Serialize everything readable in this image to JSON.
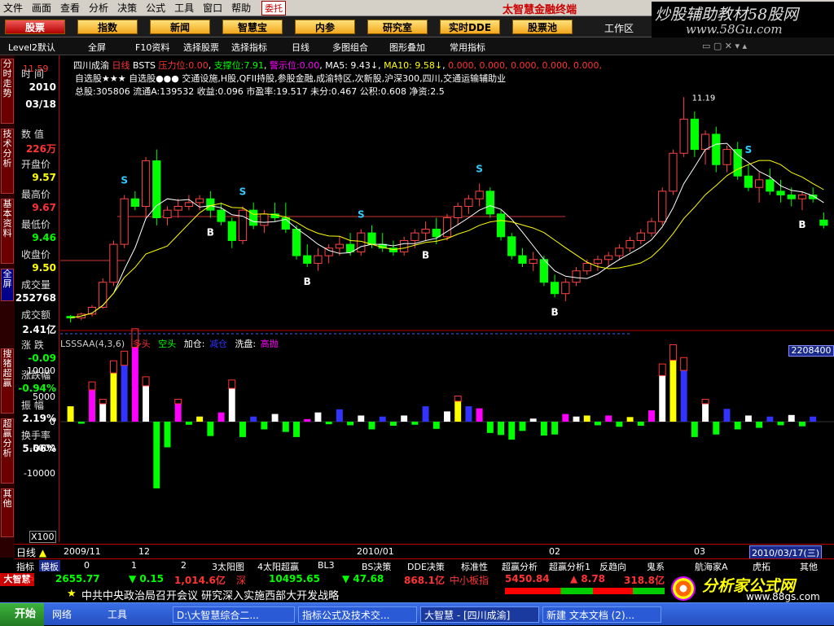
{
  "menubar": {
    "items": [
      "文件",
      "画面",
      "查看",
      "分析",
      "决策",
      "公式",
      "工具",
      "窗口",
      "帮助"
    ],
    "weituo": "委托",
    "brand": "太智慧金融终端"
  },
  "watermark": {
    "line1": "炒股辅助教材58股网",
    "line2": "www.58Gu.com"
  },
  "toolbar": {
    "buttons": [
      "股票",
      "指数",
      "新闻",
      "智慧宝",
      "内参",
      "研究室",
      "实时DDE",
      "股票池"
    ],
    "workarea": "工作区"
  },
  "subbar": {
    "items": [
      "Level2默认",
      "全屏",
      "F10资料",
      "选择股票",
      "选择指标",
      "日线",
      "多图组合",
      "图形叠加",
      "常用指标"
    ]
  },
  "lefttabs": [
    "分时走势",
    "技术分析",
    "基本资料",
    "全屏",
    "搜猪超赢",
    "超赢分析",
    "其他"
  ],
  "leftpanel": {
    "rows": [
      {
        "label": "时 间",
        "value": "2010",
        "color": "#fff"
      },
      {
        "label": "",
        "value": "03/18",
        "color": "#fff"
      },
      {
        "label": "数 值",
        "value": "226万",
        "color": "#f33"
      },
      {
        "label": "开盘价",
        "value": "9.57",
        "color": "#ff0"
      },
      {
        "label": "最高价",
        "value": "9.67",
        "color": "#f33"
      },
      {
        "label": "最低价",
        "value": "9.46",
        "color": "#0f0"
      },
      {
        "label": "收盘价",
        "value": "9.50",
        "color": "#ff0"
      },
      {
        "label": "成交量",
        "value": "252768",
        "color": "#fff"
      },
      {
        "label": "成交额",
        "value": "2.41亿",
        "color": "#fff"
      },
      {
        "label": "涨 跌",
        "value": "-0.09",
        "color": "#0f0"
      },
      {
        "label": "涨跌幅",
        "value": "-0.94%",
        "color": "#0f0"
      },
      {
        "label": "振 幅",
        "value": "2.19%",
        "color": "#fff"
      },
      {
        "label": "换手率",
        "value": "5.06%",
        "color": "#fff"
      }
    ],
    "top_price": "11.59"
  },
  "header": {
    "line1": {
      "name": "四川成渝",
      "period": "日线",
      "formula": "BSTS",
      "pressure_label": "压力位:",
      "pressure": "0.00",
      "support_label": "支撑位:",
      "support": "7.91",
      "warn_label": "警示位:",
      "warn": "0.00",
      "ma5": "MA5: 9.43↓",
      "ma10": "MA10: 9.58↓",
      "rest": "0.000, 0.000, 0.000, 0.000, 0.000,"
    },
    "line2": "自选股★★★ 自选股●●● 交通设施,H股,QFII持股,参股金融,成渝特区,次新股,沪深300,四川,交通运输辅助业",
    "line3": "总股:305806 流通A:139532 收益:0.096 市盈率:19.517 未分:0.467 公积:0.608 净资:2.5"
  },
  "subchart": {
    "name": "LSSSAA(4,3,6)",
    "legend": [
      {
        "t": "多头",
        "c": "#f33"
      },
      {
        "t": "空头",
        "c": "#0f0"
      },
      {
        "t": "加仓:",
        "c": "#fff"
      },
      {
        "t": "减仓",
        "c": "#33f"
      },
      {
        "t": "洗盘:",
        "c": "#fff"
      },
      {
        "t": "高抛",
        "c": "#f0f"
      }
    ],
    "bigval": "2208400"
  },
  "xaxis": {
    "period": "日线",
    "labels": [
      "2009/11",
      "12",
      "2010/01",
      "02",
      "03"
    ],
    "current": "2010/03/17(三)",
    "zoom": "X100"
  },
  "tabs": [
    "指标",
    "模板",
    "0",
    "1",
    "2",
    "3太阳图",
    "4太阳超赢",
    "BL3",
    "BS决策",
    "DDE决策",
    "标准性",
    "超赢分析",
    "超赢分析1",
    "反趋向",
    "鬼系",
    "航海家A",
    "虎拓",
    "其他"
  ],
  "status": {
    "sh_label": "沪",
    "sh": "2655.77",
    "sh_chg": "▼ 0.15",
    "sh_amt": "1,014.6亿",
    "sz_label": "深",
    "sz": "10495.65",
    "sz_chg": "▼ 47.68",
    "sz_amt": "868.1亿",
    "news": "中共中央政治局召开会议 研究深入实施西部大开发战略",
    "sme_label": "中小板指",
    "sme": "5450.84",
    "sme_chg": "▲ 8.78",
    "sme_amt": "318.8亿",
    "logo_left": "大智慧"
  },
  "taskbar": {
    "start": "开始",
    "items": [
      "网络",
      "工具",
      "D:\\大智慧综合二...",
      "指标公式及技术交...",
      "大智慧 - [四川成渝]",
      "新建 文本文档 (2)..."
    ]
  },
  "logo": {
    "text": "分析家公式网",
    "url": "www.88gs.com"
  },
  "chart_data": {
    "type": "candlestick",
    "ylim": [
      8.2,
      11.59
    ],
    "ma_lines": [
      "MA5",
      "MA10"
    ],
    "candles": [
      [
        8.3,
        8.32,
        8.22,
        8.28
      ],
      [
        8.28,
        8.35,
        8.25,
        8.33
      ],
      [
        8.33,
        8.45,
        8.3,
        8.42
      ],
      [
        8.42,
        8.8,
        8.4,
        8.75
      ],
      [
        8.75,
        9.3,
        8.7,
        9.25
      ],
      [
        9.25,
        9.9,
        9.2,
        9.85
      ],
      [
        9.85,
        9.95,
        9.7,
        9.75
      ],
      [
        9.75,
        10.4,
        9.6,
        10.35
      ],
      [
        10.35,
        10.5,
        9.5,
        9.6
      ],
      [
        9.6,
        9.75,
        9.5,
        9.7
      ],
      [
        9.7,
        9.85,
        9.6,
        9.75
      ],
      [
        9.75,
        9.9,
        9.7,
        9.8
      ],
      [
        9.8,
        9.9,
        9.7,
        9.85
      ],
      [
        9.85,
        9.95,
        9.6,
        9.7
      ],
      [
        9.7,
        9.8,
        9.5,
        9.55
      ],
      [
        9.55,
        9.6,
        9.2,
        9.3
      ],
      [
        9.3,
        9.75,
        9.25,
        9.7
      ],
      [
        9.7,
        9.8,
        9.45,
        9.5
      ],
      [
        9.5,
        9.7,
        9.4,
        9.65
      ],
      [
        9.65,
        9.8,
        9.55,
        9.6
      ],
      [
        9.6,
        9.8,
        9.4,
        9.45
      ],
      [
        9.45,
        9.5,
        9.05,
        9.1
      ],
      [
        9.1,
        9.25,
        8.95,
        9.0
      ],
      [
        9.0,
        9.2,
        8.9,
        9.1
      ],
      [
        9.1,
        9.25,
        9.0,
        9.2
      ],
      [
        9.2,
        9.35,
        9.1,
        9.25
      ],
      [
        9.25,
        9.4,
        9.1,
        9.15
      ],
      [
        9.15,
        9.45,
        9.1,
        9.4
      ],
      [
        9.4,
        9.5,
        9.2,
        9.25
      ],
      [
        9.25,
        9.4,
        9.15,
        9.2
      ],
      [
        9.2,
        9.3,
        9.1,
        9.15
      ],
      [
        9.15,
        9.35,
        9.1,
        9.3
      ],
      [
        9.3,
        9.45,
        9.2,
        9.4
      ],
      [
        9.4,
        9.55,
        9.3,
        9.45
      ],
      [
        9.45,
        9.6,
        9.25,
        9.35
      ],
      [
        9.35,
        9.65,
        9.3,
        9.6
      ],
      [
        9.6,
        9.8,
        9.5,
        9.75
      ],
      [
        9.75,
        9.9,
        9.65,
        9.85
      ],
      [
        9.85,
        10.05,
        9.75,
        9.95
      ],
      [
        9.95,
        10.0,
        9.6,
        9.65
      ],
      [
        9.65,
        9.7,
        9.3,
        9.35
      ],
      [
        9.35,
        9.4,
        9.05,
        9.1
      ],
      [
        9.1,
        9.2,
        8.95,
        9.0
      ],
      [
        9.0,
        9.15,
        8.9,
        9.05
      ],
      [
        9.05,
        9.1,
        8.7,
        8.75
      ],
      [
        8.75,
        8.85,
        8.55,
        8.6
      ],
      [
        8.6,
        8.8,
        8.5,
        8.75
      ],
      [
        8.75,
        8.95,
        8.7,
        8.9
      ],
      [
        8.9,
        9.05,
        8.85,
        9.0
      ],
      [
        9.0,
        9.1,
        8.9,
        9.05
      ],
      [
        9.05,
        9.15,
        8.95,
        9.1
      ],
      [
        9.1,
        9.25,
        9.05,
        9.2
      ],
      [
        9.2,
        9.35,
        9.15,
        9.3
      ],
      [
        9.3,
        9.45,
        9.25,
        9.4
      ],
      [
        9.4,
        9.6,
        9.35,
        9.55
      ],
      [
        9.55,
        10.0,
        9.5,
        9.95
      ],
      [
        9.95,
        10.5,
        9.9,
        10.45
      ],
      [
        10.45,
        11.19,
        10.4,
        10.9
      ],
      [
        10.9,
        11.0,
        10.4,
        10.5
      ],
      [
        10.5,
        10.75,
        10.3,
        10.7
      ],
      [
        10.7,
        10.8,
        10.2,
        10.3
      ],
      [
        10.3,
        10.55,
        10.2,
        10.5
      ],
      [
        10.5,
        10.6,
        10.1,
        10.15
      ],
      [
        10.15,
        10.3,
        9.95,
        10.0
      ],
      [
        10.0,
        10.2,
        9.8,
        10.1
      ],
      [
        10.1,
        10.25,
        9.9,
        9.95
      ],
      [
        9.95,
        10.1,
        9.8,
        9.9
      ],
      [
        9.9,
        10.0,
        9.75,
        9.85
      ],
      [
        9.85,
        9.95,
        9.7,
        9.9
      ],
      [
        9.9,
        10.0,
        9.8,
        9.85
      ],
      [
        9.57,
        9.67,
        9.46,
        9.5
      ]
    ],
    "volume_bars": [
      [
        1,
        3000
      ],
      [
        -1,
        -400
      ],
      [
        1,
        6200
      ],
      [
        1,
        3500
      ],
      [
        1,
        9500
      ],
      [
        1,
        11000
      ],
      [
        1,
        14500
      ],
      [
        1,
        7000
      ],
      [
        -1,
        -13000
      ],
      [
        -1,
        -5000
      ],
      [
        1,
        3500
      ],
      [
        -1,
        -600
      ],
      [
        1,
        1000
      ],
      [
        -1,
        -2800
      ],
      [
        1,
        1800
      ],
      [
        1,
        6500
      ],
      [
        -1,
        -3000
      ],
      [
        1,
        1000
      ],
      [
        -1,
        -1500
      ],
      [
        1,
        1500
      ],
      [
        -1,
        -2000
      ],
      [
        -1,
        -3000
      ],
      [
        1,
        500
      ],
      [
        1,
        1800
      ],
      [
        -1,
        -500
      ],
      [
        1,
        2400
      ],
      [
        -1,
        -700
      ],
      [
        1,
        1200
      ],
      [
        -1,
        -1500
      ],
      [
        1,
        1000
      ],
      [
        -1,
        -800
      ],
      [
        1,
        1200
      ],
      [
        -1,
        -600
      ],
      [
        1,
        3000
      ],
      [
        -1,
        -1400
      ],
      [
        1,
        2000
      ],
      [
        1,
        4000
      ],
      [
        1,
        3000
      ],
      [
        1,
        2600
      ],
      [
        -1,
        -2200
      ],
      [
        -1,
        -2600
      ],
      [
        -1,
        -3500
      ],
      [
        -1,
        -1800
      ],
      [
        1,
        600
      ],
      [
        -1,
        -2700
      ],
      [
        -1,
        -2500
      ],
      [
        1,
        1500
      ],
      [
        1,
        1000
      ],
      [
        1,
        1200
      ],
      [
        -1,
        -700
      ],
      [
        1,
        1200
      ],
      [
        -1,
        -1000
      ],
      [
        1,
        900
      ],
      [
        -1,
        -800
      ],
      [
        1,
        2200
      ],
      [
        1,
        9000
      ],
      [
        1,
        12000
      ],
      [
        1,
        10000
      ],
      [
        -1,
        -3000
      ],
      [
        1,
        3500
      ],
      [
        -1,
        -2500
      ],
      [
        1,
        2500
      ],
      [
        -1,
        -1500
      ],
      [
        1,
        1200
      ],
      [
        -1,
        -1200
      ],
      [
        1,
        1000
      ],
      [
        -1,
        -700
      ],
      [
        1,
        1300
      ],
      [
        -1,
        -900
      ],
      [
        1,
        1000
      ]
    ],
    "y_ticks_sub": [
      10000,
      5000,
      0,
      -5000,
      -10000
    ]
  }
}
